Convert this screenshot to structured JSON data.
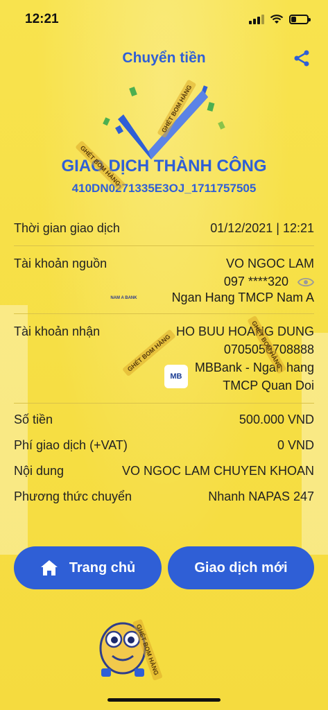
{
  "status_bar": {
    "time": "12:21"
  },
  "header": {
    "title": "Chuyển tiền",
    "share_icon": "share-icon"
  },
  "result": {
    "title": "GIAO DỊCH THÀNH CÔNG",
    "code": "410DN0271335E3OJ_1711757505"
  },
  "details": {
    "time_label": "Thời gian giao dịch",
    "time_value": "01/12/2021 | 12:21",
    "source_label": "Tài khoản nguồn",
    "source_name": "VO NGOC LAM",
    "source_account": "097 ****320",
    "source_bank_logo": "NAM A BANK",
    "source_bank": "Ngan Hang TMCP Nam A",
    "dest_label": "Tài khoản nhận",
    "dest_name": "HO BUU HOANG DUNG",
    "dest_account": "0705050708888",
    "dest_bank_logo": "MB",
    "dest_bank_line1": "MBBank - Ngan hang",
    "dest_bank_line2": "TMCP Quan Doi",
    "amount_label": "Số tiền",
    "amount_value": "500.000 VND",
    "fee_label": "Phí giao dịch (+VAT)",
    "fee_value": "0 VND",
    "content_label": "Nội dung",
    "content_value": "VO NGOC LAM CHUYEN KHOAN",
    "method_label": "Phương thức chuyển",
    "method_value": "Nhanh NAPAS 247"
  },
  "buttons": {
    "home": "Trang chủ",
    "new": "Giao dịch mới"
  },
  "watermark": "GHÉT BOM HÀNG",
  "colors": {
    "background": "#f7e24a",
    "accent": "#2f5fd6"
  }
}
